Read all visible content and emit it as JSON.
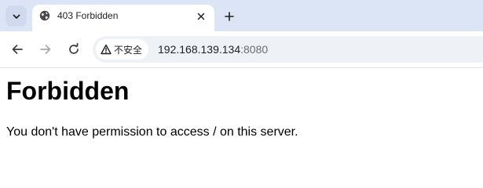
{
  "tab": {
    "title": "403 Forbidden",
    "favicon_icon": "globe-icon",
    "close_icon": "close-icon"
  },
  "toolbar": {
    "back_icon": "arrow-left-icon",
    "forward_icon": "arrow-right-icon",
    "reload_icon": "reload-icon",
    "security_label": "不安全",
    "url_host": "192.168.139.134",
    "url_port": ":8080"
  },
  "page": {
    "heading": "Forbidden",
    "message": "You don't have permission to access / on this server."
  },
  "colors": {
    "tabstrip_bg": "#dbe5f5",
    "omnibox_bg": "#eef1f6"
  }
}
